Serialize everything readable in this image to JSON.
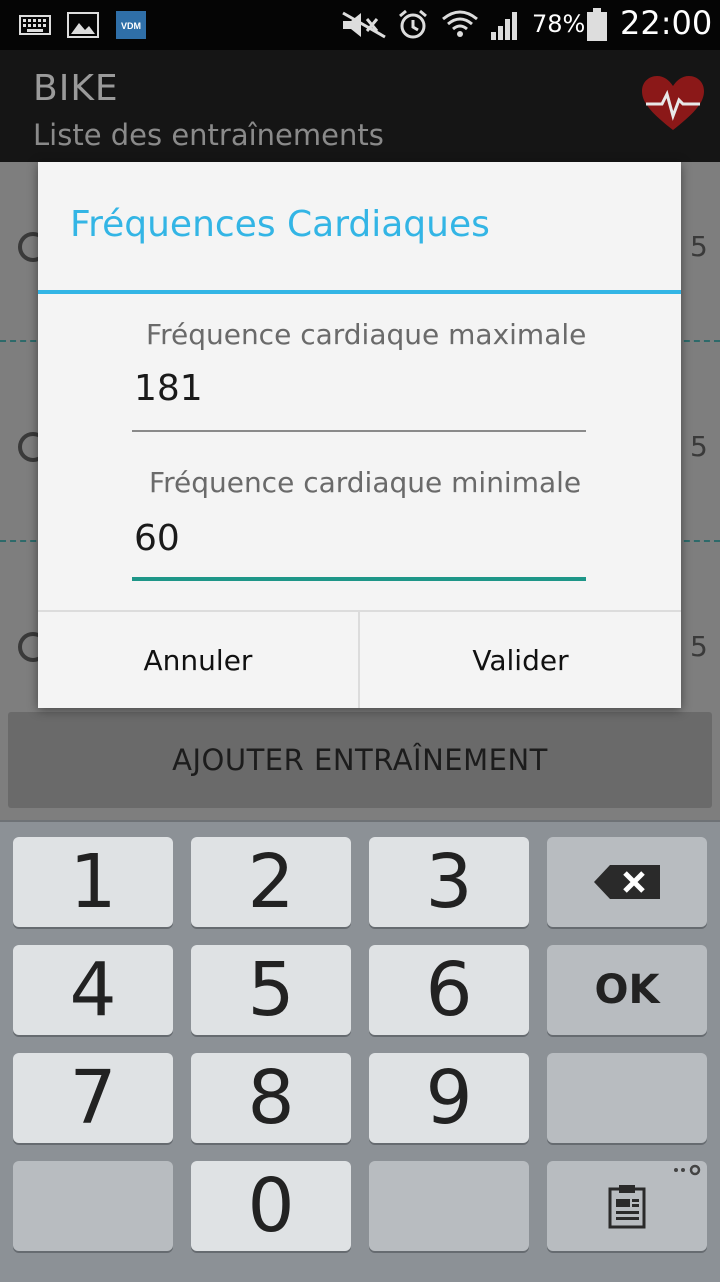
{
  "status_bar": {
    "battery": "78%",
    "time": "22:00",
    "icons": [
      "keyboard-icon",
      "image-icon",
      "vdm-app-icon",
      "mute-icon",
      "alarm-icon",
      "wifi-icon",
      "signal-icon",
      "battery-icon"
    ],
    "vdm_label": "VDM"
  },
  "app_bar": {
    "title": "BIKE",
    "subtitle": "Liste des entraînements",
    "logo": "heart-rate-icon"
  },
  "list": {
    "row_values": [
      "5",
      "5",
      "5"
    ]
  },
  "add_button_label": "AJOUTER ENTRAÎNEMENT",
  "dialog": {
    "title": "Fréquences Cardiaques",
    "max_label": "Fréquence cardiaque maximale",
    "max_value": "181",
    "min_label": "Fréquence cardiaque minimale",
    "min_value": "60",
    "cancel_label": "Annuler",
    "confirm_label": "Valider",
    "accent_color": "#33b5e5",
    "focus_color": "#1e9688"
  },
  "keyboard": {
    "keys": [
      "1",
      "2",
      "3",
      "4",
      "5",
      "6",
      "7",
      "8",
      "9",
      "0"
    ],
    "ok_label": "OK",
    "icons": [
      "backspace-icon",
      "clipboard-icon",
      "settings-icon"
    ]
  }
}
